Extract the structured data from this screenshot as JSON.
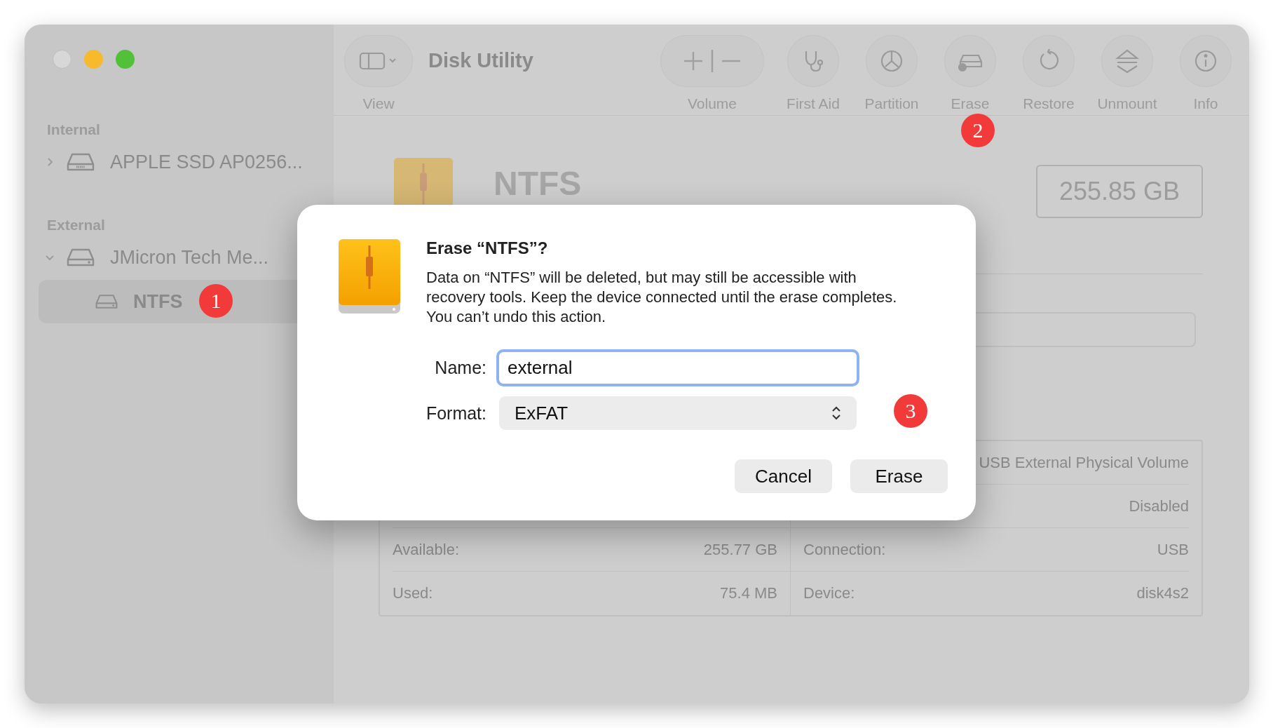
{
  "window": {
    "title": "Disk Utility"
  },
  "toolbar": {
    "view_label": "View",
    "items": [
      {
        "kind": "volume",
        "label": "Volume"
      },
      {
        "kind": "first_aid",
        "label": "First Aid"
      },
      {
        "kind": "partition",
        "label": "Partition"
      },
      {
        "kind": "erase",
        "label": "Erase"
      },
      {
        "kind": "restore",
        "label": "Restore"
      },
      {
        "kind": "unmount",
        "label": "Unmount"
      },
      {
        "kind": "info",
        "label": "Info"
      }
    ]
  },
  "sidebar": {
    "sections": [
      {
        "title": "Internal",
        "items": [
          {
            "label": "APPLE SSD AP0256...",
            "kind": "ssd",
            "expanded": false,
            "selected": false
          }
        ]
      },
      {
        "title": "External",
        "items": [
          {
            "label": "JMicron Tech Me...",
            "kind": "disk",
            "expanded": true,
            "selected": false,
            "children": [
              {
                "label": "NTFS",
                "selected": true
              }
            ]
          }
        ]
      }
    ]
  },
  "volume": {
    "name": "NTFS",
    "capacity": "255.85 GB"
  },
  "info_rows": [
    {
      "right_value": "USB External Physical Volume"
    },
    {
      "right_value": "Disabled"
    },
    {
      "left_label": "Available:",
      "left_value": "255.77 GB",
      "right_label": "Connection:",
      "right_value": "USB"
    },
    {
      "left_label": "Used:",
      "left_value": "75.4 MB",
      "right_label": "Device:",
      "right_value": "disk4s2"
    }
  ],
  "dialog": {
    "title": "Erase “NTFS”?",
    "message": "Data on “NTFS” will be deleted, but may still be accessible with recovery tools. Keep the device connected until the erase completes. You can’t undo this action.",
    "name_label": "Name:",
    "name_value": "external",
    "format_label": "Format:",
    "format_value": "ExFAT",
    "buttons": [
      "Cancel",
      "Erase"
    ]
  },
  "annotations": [
    {
      "label": "1"
    },
    {
      "label": "2"
    },
    {
      "label": "3"
    }
  ]
}
